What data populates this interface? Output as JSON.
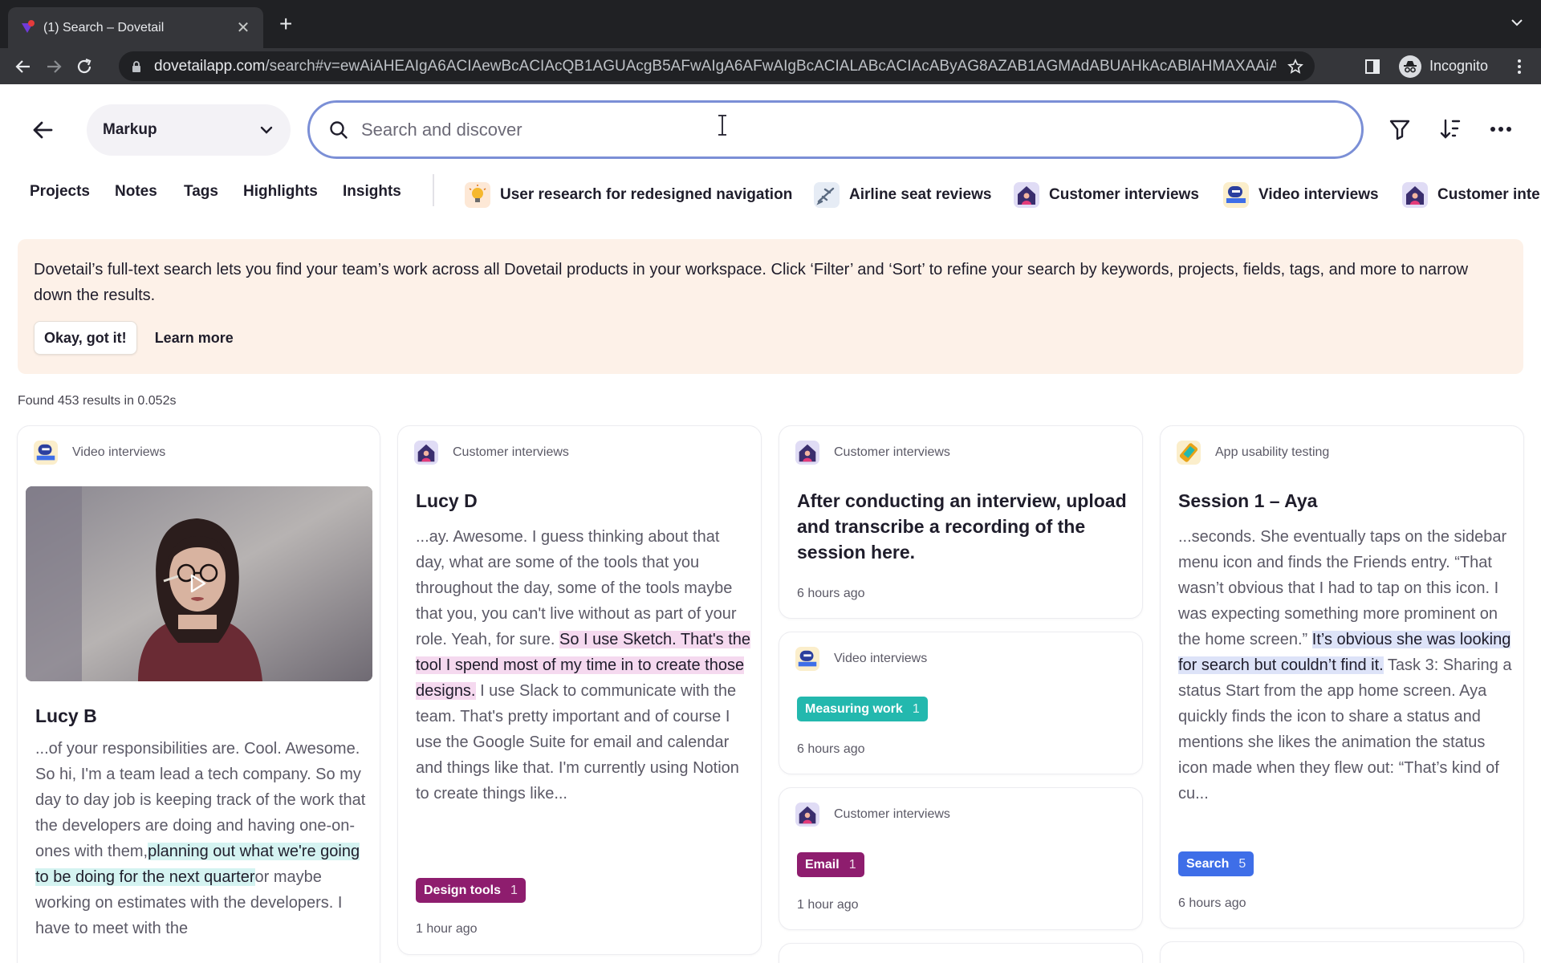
{
  "browser": {
    "tab_title": "(1) Search – Dovetail",
    "url_host": "dovetailapp.com",
    "url_path": "/search#v=ewAiAHEAIgA6ACIAewBcACIAcQB1AGUAcgB5AFwAIgA6AFwAIgBcACIALABcACIAcAByAG8AZAB1AGMAdABUAHkAcABlAHMAXAAiAD...",
    "profile_label": "Incognito"
  },
  "header": {
    "workspace": "Markup",
    "search_placeholder": "Search and discover"
  },
  "nav": {
    "links": [
      "Projects",
      "Notes",
      "Tags",
      "Highlights",
      "Insights"
    ],
    "projects": [
      {
        "label": "User research for redesigned navigation",
        "icon": "lightbulb-icon"
      },
      {
        "label": "Airline seat reviews",
        "icon": "airplane-icon"
      },
      {
        "label": "Customer interviews",
        "icon": "house-person-icon"
      },
      {
        "label": "Video interviews",
        "icon": "interview-icon"
      },
      {
        "label": "Customer inte",
        "icon": "house-person-icon"
      }
    ]
  },
  "banner": {
    "text": "Dovetail’s full-text search lets you find your team’s work across all Dovetail products in your workspace. Click ‘Filter’ and ‘Sort’ to refine your search by keywords, projects, fields, tags, and more to narrow down the results.",
    "okay_label": "Okay, got it!",
    "learn_label": "Learn more"
  },
  "results": {
    "count_text": "Found 453 results in 0.052s",
    "cards": [
      {
        "project": "Video interviews",
        "title": "Lucy B",
        "text_before": "...of your responsibilities are. Cool. Awesome. So hi, I'm a team lead a tech company. So my day to day job is keeping track of the work that the developers are doing and having one-on-ones with them,",
        "highlight": "planning out what we're going to be doing for the next quarter",
        "text_after": "or maybe working on estimates with the developers. I have to meet with the"
      },
      {
        "project": "Customer interviews",
        "title": "Lucy D",
        "text_before": "...ay. Awesome. I guess thinking about that day, what are some of the tools that you throughout the day, some of the tools maybe that you, you can't live without as part of your role. Yeah, for sure.",
        "highlight": "So I use Sketch. That's the tool I spend most of my time in to create those designs.",
        "text_after": "I use Slack to communicate with the team. That's pretty important and of course I use the Google Suite for email and calendar and things like that. I'm currently using Notion to create things like...",
        "tag": {
          "label": "Design tools",
          "count": "1",
          "color": "#8e1d6e"
        },
        "time": "1 hour ago"
      },
      {
        "project": "Customer interviews",
        "title": "After conducting an interview, upload and transcribe a recording of the session here.",
        "time": "6 hours ago"
      },
      {
        "project": "Video interviews",
        "tag": {
          "label": "Measuring work",
          "count": "1",
          "color": "#23b8ae"
        },
        "time": "6 hours ago"
      },
      {
        "project": "Customer interviews",
        "tag": {
          "label": "Email",
          "count": "1",
          "color": "#8e1d6e"
        },
        "time": "1 hour ago"
      },
      {
        "project": "App usability testing",
        "title": "Session 1 – Aya",
        "text_before": "...seconds. She eventually taps on the sidebar menu icon and finds the Friends entry. “That wasn’t obvious that I had to tap on this icon. I was expecting something more prominent on the home screen.”",
        "highlight": "It’s obvious she was looking for search but couldn’t find it.",
        "text_after": "Task 3: Sharing a status Start from the app home screen. Aya quickly finds the icon to share a status and mentions she likes the animation the status icon made when they flew out: “That’s kind of cu...",
        "tag": {
          "label": "Search",
          "count": "5",
          "color": "#3e6ee8"
        },
        "time": "6 hours ago"
      }
    ]
  }
}
